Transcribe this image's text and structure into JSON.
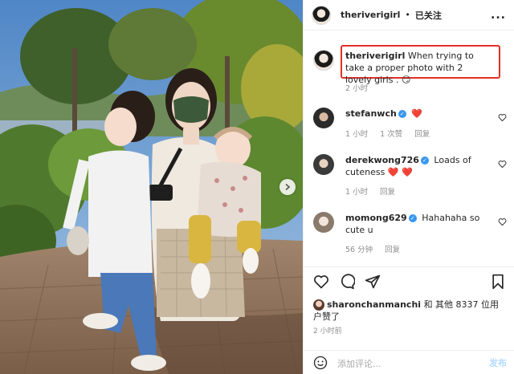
{
  "header": {
    "username": "theriverigirl",
    "separator": "•",
    "follow_status": "已关注",
    "more": "..."
  },
  "comments": [
    {
      "username": "theriverigirl",
      "text": "When trying to take a proper photo with 2 lovely girls . 😏",
      "time": "2 小时",
      "verified": false
    },
    {
      "username": "stefanwch",
      "text": "❤️",
      "time": "1 小时",
      "likes": "1 次赞",
      "reply": "回复",
      "verified": true
    },
    {
      "username": "derekwong726",
      "text": "Loads of cuteness ❤️ ❤️",
      "time": "1 小时",
      "reply": "回复",
      "verified": true
    },
    {
      "username": "momong629",
      "text": "Hahahaha so cute u",
      "time": "56 分钟",
      "reply": "回复",
      "verified": true
    }
  ],
  "likes": {
    "username": "sharonchanmanchi",
    "text": "和 其他 8337 位用户赞了"
  },
  "post_time": "2 小时前",
  "add_comment": {
    "placeholder": "添加评论...",
    "post_label": "发布"
  },
  "icons": [
    "heart-icon",
    "comment-icon",
    "share-icon",
    "bookmark-icon",
    "emoji-icon",
    "chevron-right-icon"
  ],
  "colors": {
    "highlight": "#e03127",
    "verified": "#3897f0",
    "like_heart": "#ed4956"
  }
}
